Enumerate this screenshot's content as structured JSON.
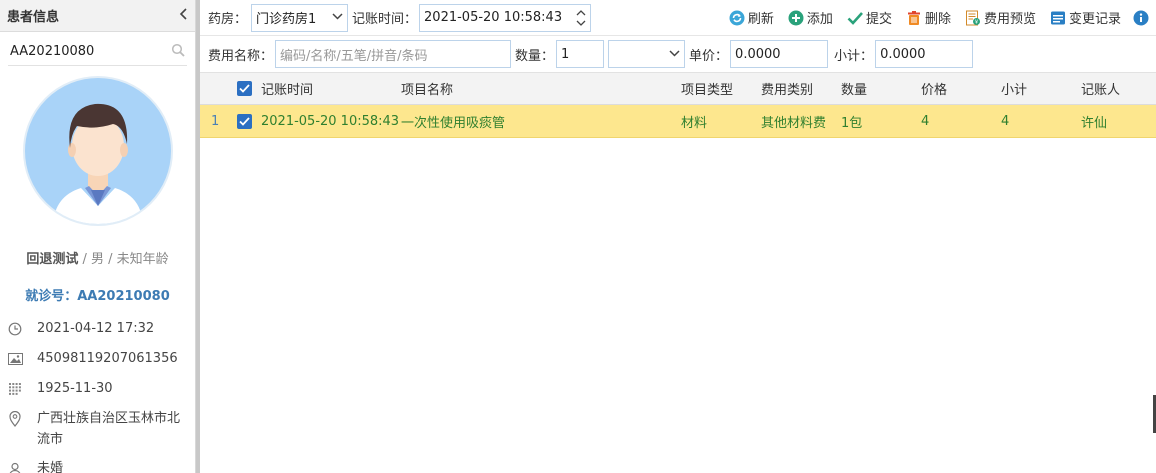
{
  "sidebar": {
    "title": "患者信息",
    "search_value": "AA20210080",
    "patient_name": "回退测试",
    "patient_rest": " / 男 / 未知年龄",
    "visit_label": "就诊号：",
    "visit_no": "AA20210080",
    "info": [
      {
        "icon": "clock-icon",
        "text": "2021-04-12 17:32"
      },
      {
        "icon": "id-card-icon",
        "text": "45098119207061356"
      },
      {
        "icon": "calendar-icon",
        "text": "1925-11-30"
      },
      {
        "icon": "location-icon",
        "text": "广西壮族自治区玉林市北流市"
      },
      {
        "icon": "person-icon",
        "text": "未婚"
      }
    ]
  },
  "form": {
    "pharmacy_label": "药房：",
    "pharmacy_value": "门诊药房1",
    "time_label": "记账时间：",
    "time_value": "2021-05-20 10:58:43",
    "fee_name_label": "费用名称：",
    "fee_name_placeholder": "编码/名称/五笔/拼音/条码",
    "qty_label": "数量：",
    "qty_value": "1",
    "unit_value": "",
    "price_label": "单价：",
    "price_value": "0.0000",
    "subtotal_label": "小计：",
    "subtotal_value": "0.0000"
  },
  "toolbar": {
    "refresh": "刷新",
    "add": "添加",
    "submit": "提交",
    "delete": "删除",
    "preview": "费用预览",
    "history": "变更记录"
  },
  "grid": {
    "headers": [
      "记账时间",
      "项目名称",
      "项目类型",
      "费用类别",
      "数量",
      "价格",
      "小计",
      "记账人"
    ],
    "rows": [
      {
        "no": "1",
        "time": "2021-05-20 10:58:43",
        "item": "一次性使用吸痰管",
        "type": "材料",
        "category": "其他材料费",
        "qty": "1包",
        "price": "4",
        "subtotal": "4",
        "recorder": "许仙"
      }
    ]
  },
  "colors": {
    "accent": "#2b6fc2",
    "row_highlight": "#fde78e",
    "row_text": "#2f7f2f",
    "visit_no": "#3d7bb3"
  }
}
